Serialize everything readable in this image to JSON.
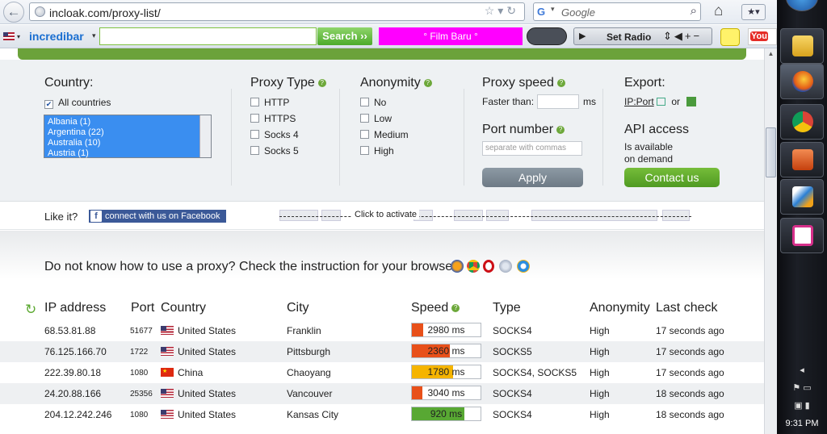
{
  "browser": {
    "url": "incloak.com/proxy-list/",
    "search_placeholder": "Google",
    "search_engine_icon": "G"
  },
  "toolbar": {
    "brand": "incredibar",
    "search_button": "Search ››",
    "film_label": "° Film Baru °",
    "set_radio": "Set Radio",
    "youtube": "You"
  },
  "filter": {
    "country": {
      "title": "Country:",
      "all_label": "All countries",
      "options": [
        "Albania (1)",
        "Argentina (22)",
        "Australia (10)",
        "Austria (1)"
      ]
    },
    "proxy_type": {
      "title": "Proxy Type",
      "options": [
        "HTTP",
        "HTTPS",
        "Socks 4",
        "Socks 5"
      ]
    },
    "anonymity": {
      "title": "Anonymity",
      "options": [
        "No",
        "Low",
        "Medium",
        "High"
      ]
    },
    "speed": {
      "title": "Proxy speed",
      "faster_than": "Faster than:",
      "unit": "ms"
    },
    "port": {
      "title": "Port number",
      "placeholder": "separate with commas"
    },
    "apply": "Apply",
    "export": {
      "title": "Export:",
      "ipport": "IP:Port",
      "or": "or"
    },
    "api": {
      "title": "API access",
      "line1": "Is available",
      "line2": "on demand",
      "contact": "Contact us"
    }
  },
  "social": {
    "like": "Like it?",
    "facebook": "connect with us on Facebook",
    "activate": "Click to activate"
  },
  "instructions": "Do not know how to use a proxy? Check the instruction for your browser:",
  "table": {
    "headers": {
      "ip": "IP address",
      "port": "Port",
      "country": "Country",
      "city": "City",
      "speed": "Speed",
      "type": "Type",
      "anonymity": "Anonymity",
      "last": "Last check"
    },
    "rows": [
      {
        "ip": "68.53.81.88",
        "port": "51677",
        "country": "United States",
        "flag": "us",
        "city": "Franklin",
        "speed": "2980 ms",
        "speed_fill": 0.16,
        "speed_color": "#e8501a",
        "type": "SOCKS4",
        "anon": "High",
        "last": "17 seconds ago"
      },
      {
        "ip": "76.125.166.70",
        "port": "1722",
        "country": "United States",
        "flag": "us",
        "city": "Pittsburgh",
        "speed": "2360 ms",
        "speed_fill": 0.55,
        "speed_color": "#e8501a",
        "type": "SOCKS5",
        "anon": "High",
        "last": "17 seconds ago"
      },
      {
        "ip": "222.39.80.18",
        "port": "1080",
        "country": "China",
        "flag": "cn",
        "city": "Chaoyang",
        "speed": "1780 ms",
        "speed_fill": 0.6,
        "speed_color": "#f5b400",
        "type": "SOCKS4, SOCKS5",
        "anon": "High",
        "last": "17 seconds ago"
      },
      {
        "ip": "24.20.88.166",
        "port": "25356",
        "country": "United States",
        "flag": "us",
        "city": "Vancouver",
        "speed": "3040 ms",
        "speed_fill": 0.15,
        "speed_color": "#e8501a",
        "type": "SOCKS4",
        "anon": "High",
        "last": "18 seconds ago"
      },
      {
        "ip": "204.12.242.246",
        "port": "1080",
        "country": "United States",
        "flag": "us",
        "city": "Kansas City",
        "speed": "920 ms",
        "speed_fill": 0.77,
        "speed_color": "#58a833",
        "type": "SOCKS4",
        "anon": "High",
        "last": "18 seconds ago"
      }
    ]
  },
  "taskbar": {
    "clock": "9:31 PM"
  }
}
